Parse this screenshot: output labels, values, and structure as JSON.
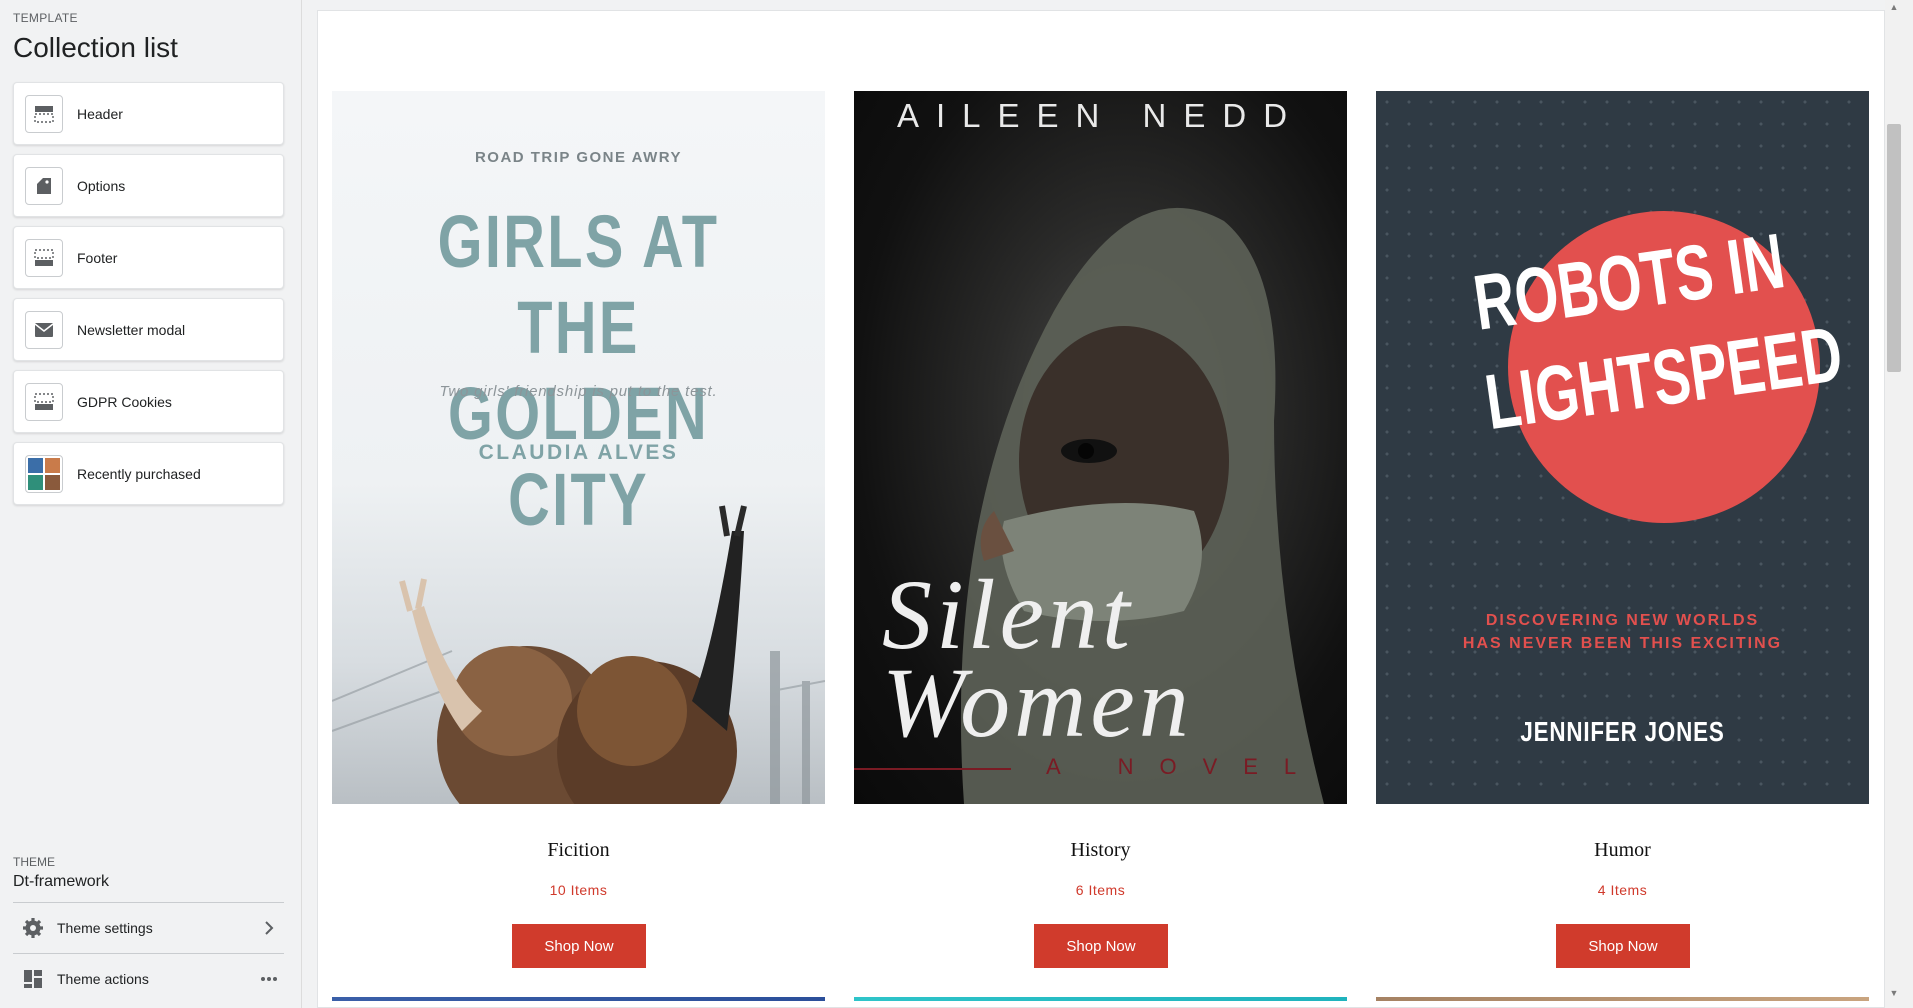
{
  "sidebar": {
    "template_label": "TEMPLATE",
    "template_title": "Collection list",
    "sections": [
      {
        "label": "Header",
        "icon": "header-layout-icon"
      },
      {
        "label": "Options",
        "icon": "tag-icon"
      },
      {
        "label": "Footer",
        "icon": "footer-layout-icon"
      },
      {
        "label": "Newsletter modal",
        "icon": "envelope-icon"
      },
      {
        "label": "GDPR Cookies",
        "icon": "footer-layout-icon"
      },
      {
        "label": "Recently purchased",
        "icon": "product-thumbnail-icon"
      }
    ],
    "theme_label": "THEME",
    "theme_name": "Dt-framework",
    "theme_settings_label": "Theme settings",
    "theme_actions_label": "Theme actions"
  },
  "collections": [
    {
      "name": "Ficition",
      "count": "10 Items",
      "button": "Shop Now",
      "cover": {
        "kicker": "ROAD TRIP GONE AWRY",
        "title": "GIRLS AT THE GOLDEN CITY",
        "subtitle": "Two girls' friendship is put to the test.",
        "author": "CLAUDIA ALVES"
      }
    },
    {
      "name": "History",
      "count": "6 Items",
      "button": "Shop Now",
      "cover": {
        "author": "AILEEN NEDD",
        "title": "Silent Women",
        "tagline": "A NOVEL"
      }
    },
    {
      "name": "Humor",
      "count": "4 Items",
      "button": "Shop Now",
      "cover": {
        "title": "ROBOTS IN LIGHTSPEED",
        "tagline_line1": "DISCOVERING NEW WORLDS",
        "tagline_line2": "HAS NEVER BEEN THIS EXCITING",
        "author": "JENNIFER JONES"
      }
    }
  ],
  "colors": {
    "accent": "#d03b2c",
    "sidebar_bg": "#f1f2f3"
  }
}
